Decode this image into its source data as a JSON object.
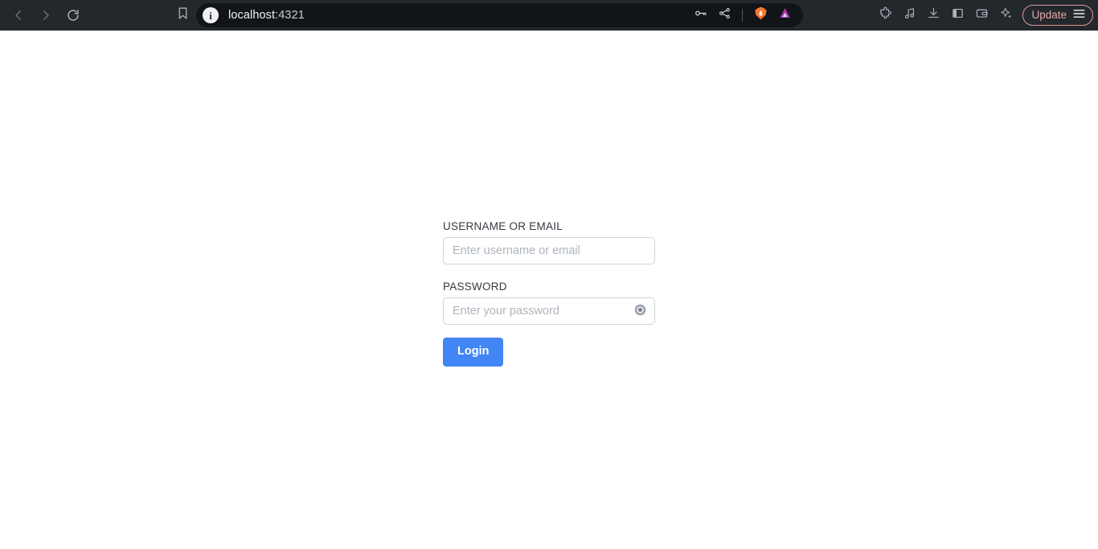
{
  "browser": {
    "nav": {
      "back_icon": "chevron-left-icon",
      "forward_icon": "chevron-right-icon",
      "reload_icon": "reload-icon"
    },
    "bookmark_icon": "bookmark-icon",
    "urlbar": {
      "site_info_icon": "info-icon",
      "site_info_glyph": "i",
      "host": "localhost",
      "port": ":4321",
      "actions": [
        {
          "name": "password-manager-icon",
          "label": "key-icon"
        },
        {
          "name": "share-icon",
          "label": "share-icon"
        },
        {
          "name": "brave-shields-icon",
          "label": "brave-lion-icon"
        },
        {
          "name": "brave-rewards-icon",
          "label": "triangle-icon"
        }
      ]
    },
    "toolbar_right": [
      {
        "name": "extensions-icon",
        "label": "puzzle-piece-icon"
      },
      {
        "name": "media-player-icon",
        "label": "music-note-icon"
      },
      {
        "name": "downloads-icon",
        "label": "download-icon"
      },
      {
        "name": "sidebar-toggle-icon",
        "label": "panel-icon"
      },
      {
        "name": "wallet-icon",
        "label": "wallet-icon"
      },
      {
        "name": "leo-ai-icon",
        "label": "sparkle-icon"
      }
    ],
    "update": {
      "label": "Update",
      "menu_icon": "hamburger-menu-icon"
    },
    "colors": {
      "toolbar_bg": "#23282c",
      "urlbar_bg": "#111418",
      "update_accent": "#e8a7a8",
      "brave_orange": "#f4772c",
      "rewards_purple": "#a03fd0"
    }
  },
  "login": {
    "username": {
      "label": "USERNAME OR EMAIL",
      "placeholder": "Enter username or email",
      "value": ""
    },
    "password": {
      "label": "PASSWORD",
      "placeholder": "Enter your password",
      "value": "",
      "toggle_icon": "eye-icon"
    },
    "submit_label": "Login",
    "colors": {
      "button_bg": "#4285f4",
      "label_text": "#343a40",
      "input_border": "#ced4da",
      "placeholder": "#adb5bd",
      "page_bg": "#ffffff"
    }
  }
}
